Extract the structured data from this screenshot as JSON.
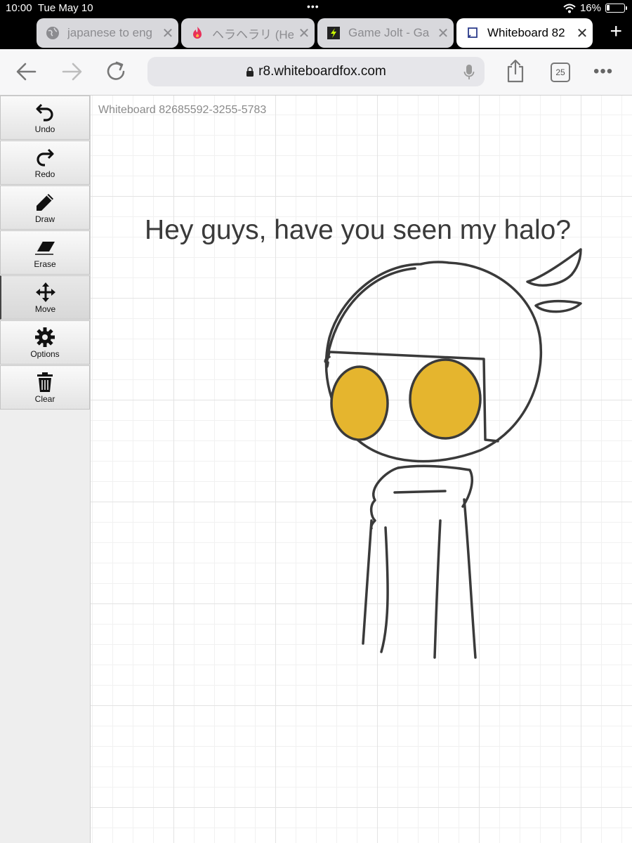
{
  "status_bar": {
    "time": "10:00",
    "date": "Tue May 10",
    "battery": "16%",
    "icons": [
      "wifi-icon",
      "battery-icon"
    ]
  },
  "tabs": [
    {
      "label": "japanese to eng",
      "icon": "globe-icon",
      "active": false
    },
    {
      "label": "ヘラヘラリ (Her",
      "icon": "flame-icon",
      "active": false
    },
    {
      "label": "Game Jolt - Ga",
      "icon": "gamejolt-icon",
      "active": false
    },
    {
      "label": "Whiteboard 82",
      "icon": "whiteboard-icon",
      "active": true
    }
  ],
  "address_bar": {
    "url": "r8.whiteboardfox.com",
    "tab_count": "25"
  },
  "toolbar": [
    {
      "label": "Undo",
      "icon": "undo-icon"
    },
    {
      "label": "Redo",
      "icon": "redo-icon"
    },
    {
      "label": "Draw",
      "icon": "pencil-icon"
    },
    {
      "label": "Erase",
      "icon": "eraser-icon"
    },
    {
      "label": "Move",
      "icon": "move-icon",
      "selected": true
    },
    {
      "label": "Options",
      "icon": "gear-icon"
    },
    {
      "label": "Clear",
      "icon": "trash-icon"
    }
  ],
  "canvas": {
    "board_id": "Whiteboard 82685592-3255-5783",
    "caption": "Hey guys, have you seen my halo?",
    "ink_color": "#3a3a3a",
    "eye_color": "#e5b52e"
  }
}
